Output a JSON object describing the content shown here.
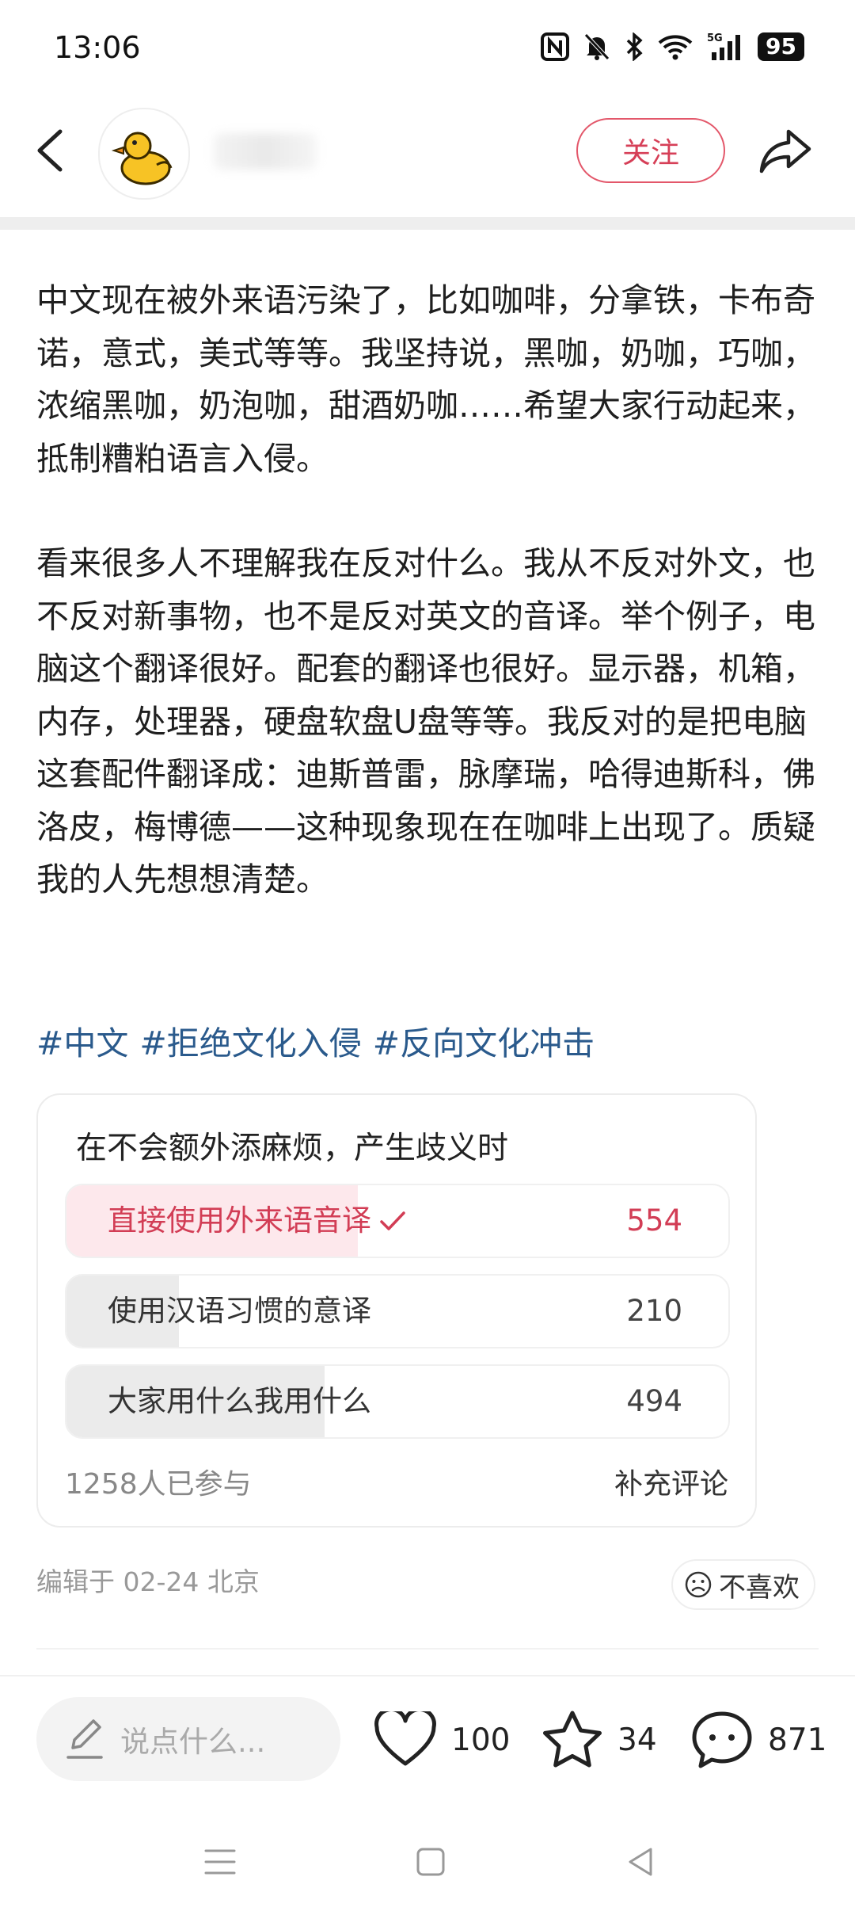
{
  "status_bar": {
    "time": "13:06",
    "icons": [
      "nfc-icon",
      "mute-bell-icon",
      "bluetooth-icon",
      "wifi-icon",
      "5g-signal-icon"
    ],
    "battery": "95"
  },
  "header": {
    "follow_label": "关注",
    "avatar_icon": "duck-avatar-icon"
  },
  "post": {
    "paragraph1": "中文现在被外来语污染了，比如咖啡，分拿铁，卡布奇诺，意式，美式等等。我坚持说，黑咖，奶咖，巧咖，浓缩黑咖，奶泡咖，甜酒奶咖……希望大家行动起来，抵制糟粕语言入侵。",
    "paragraph2": "看来很多人不理解我在反对什么。我从不反对外文，也不反对新事物，也不是反对英文的音译。举个例子，电脑这个翻译很好。配套的翻译也很好。显示器，机箱，内存，处理器，硬盘软盘U盘等等。我反对的是把电脑这套配件翻译成：迪斯普雷，脉摩瑞，哈得迪斯科，佛洛皮，梅博德——这种现象现在在咖啡上出现了。质疑我的人先想想清楚。",
    "hashtags": [
      "#中文",
      "#拒绝文化入侵",
      "#反向文化冲击"
    ]
  },
  "poll": {
    "title": "在不会额外添麻烦，产生歧义时",
    "options": [
      {
        "label": "直接使用外来语音译",
        "count": "554",
        "fraction": 0.44,
        "selected": true
      },
      {
        "label": "使用汉语习惯的意译",
        "count": "210",
        "fraction": 0.17,
        "selected": false
      },
      {
        "label": "大家用什么我用什么",
        "count": "494",
        "fraction": 0.39,
        "selected": false
      }
    ],
    "participants": "1258人已参与",
    "comment_label": "补充评论"
  },
  "meta": {
    "edited": "编辑于 02-24 北京",
    "dislike_label": "不喜欢"
  },
  "bottom_bar": {
    "comment_placeholder": "说点什么...",
    "likes": "100",
    "favorites": "34",
    "comments": "871"
  },
  "colors": {
    "accent": "#d63f57",
    "hashtag": "#2a5a8c",
    "selected_fill": "#fde8ec",
    "unselected_fill": "#ebebeb"
  }
}
